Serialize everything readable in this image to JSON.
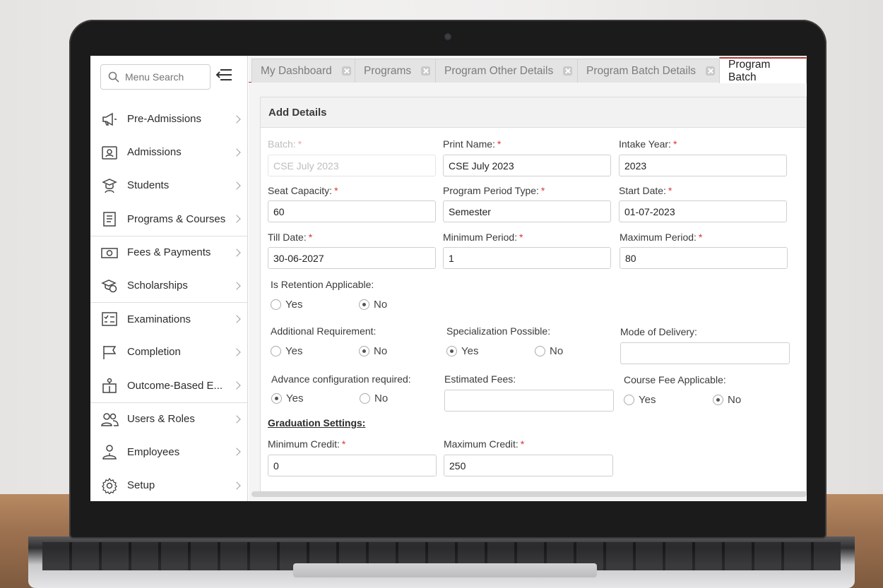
{
  "sidebar": {
    "search_placeholder": "Menu Search",
    "items": [
      {
        "label": "Pre-Admissions",
        "icon": "megaphone-icon"
      },
      {
        "label": "Admissions",
        "icon": "id-card-icon"
      },
      {
        "label": "Students",
        "icon": "graduate-icon"
      },
      {
        "label": "Programs & Courses",
        "icon": "book-icon"
      },
      {
        "label": "Fees & Payments",
        "icon": "money-icon"
      },
      {
        "label": "Scholarships",
        "icon": "scholarship-icon"
      },
      {
        "label": "Examinations",
        "icon": "checklist-icon"
      },
      {
        "label": "Completion",
        "icon": "flag-icon"
      },
      {
        "label": "Outcome-Based E...",
        "icon": "hierarchy-icon"
      },
      {
        "label": "Users & Roles",
        "icon": "users-icon"
      },
      {
        "label": "Employees",
        "icon": "employee-icon"
      },
      {
        "label": "Setup",
        "icon": "gear-icon"
      }
    ]
  },
  "tabs": [
    {
      "label": "My Dashboard"
    },
    {
      "label": "Programs"
    },
    {
      "label": "Program Other Details"
    },
    {
      "label": "Program Batch Details"
    },
    {
      "label": "Program Batch"
    }
  ],
  "panel": {
    "title": "Add Details",
    "batch": {
      "label": "Batch:",
      "value": "CSE July 2023"
    },
    "print_name": {
      "label": "Print Name:",
      "value": "CSE July 2023"
    },
    "intake_year": {
      "label": "Intake Year:",
      "value": "2023"
    },
    "seat_capacity": {
      "label": "Seat Capacity:",
      "value": "60"
    },
    "program_period_type": {
      "label": "Program Period Type:",
      "value": "Semester"
    },
    "start_date": {
      "label": "Start Date:",
      "value": "01-07-2023"
    },
    "till_date": {
      "label": "Till Date:",
      "value": "30-06-2027"
    },
    "minimum_period": {
      "label": "Minimum Period:",
      "value": "1"
    },
    "maximum_period": {
      "label": "Maximum Period:",
      "value": "80"
    },
    "retention": {
      "label": "Is Retention Applicable:",
      "yes": "Yes",
      "no": "No",
      "selected": "No"
    },
    "additional_requirement": {
      "label": "Additional Requirement:",
      "yes": "Yes",
      "no": "No",
      "selected": "No"
    },
    "specialization": {
      "label": "Specialization Possible:",
      "yes": "Yes",
      "no": "No",
      "selected": "Yes"
    },
    "mode_of_delivery": {
      "label": "Mode of Delivery:",
      "value": ""
    },
    "advance_config": {
      "label": "Advance configuration required:",
      "yes": "Yes",
      "no": "No",
      "selected": "Yes"
    },
    "estimated_fees": {
      "label": "Estimated Fees:",
      "value": ""
    },
    "course_fee": {
      "label": "Course Fee Applicable:",
      "yes": "Yes",
      "no": "No",
      "selected": "No"
    },
    "graduation_title": "Graduation Settings",
    "graduation_colon": ":",
    "minimum_credit": {
      "label": "Minimum Credit:",
      "value": "0"
    },
    "maximum_credit": {
      "label": "Maximum Credit:",
      "value": "250"
    },
    "required_mark": "*"
  },
  "colors": {
    "accent": "#b33838",
    "required": "#dd3333"
  }
}
